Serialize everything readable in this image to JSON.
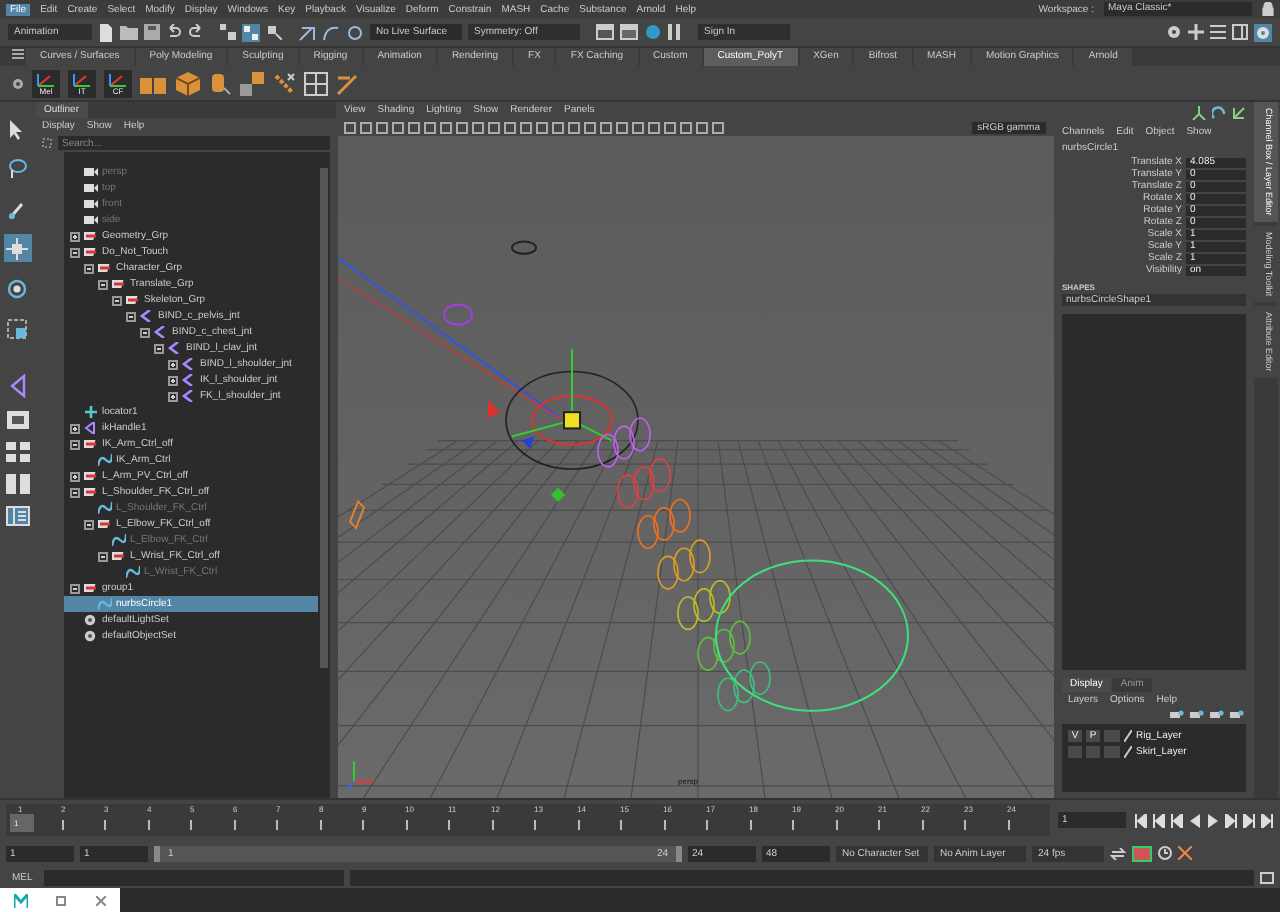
{
  "menu_bar": {
    "items": [
      {
        "label": "File",
        "selected": true
      },
      {
        "label": "Edit",
        "selected": false
      },
      {
        "label": "Create",
        "selected": false
      },
      {
        "label": "Select",
        "selected": false
      },
      {
        "label": "Modify",
        "selected": false
      },
      {
        "label": "Display",
        "selected": false
      },
      {
        "label": "Windows",
        "selected": false
      },
      {
        "label": "Key",
        "selected": false
      },
      {
        "label": "Playback",
        "selected": false
      },
      {
        "label": "Visualize",
        "selected": false
      },
      {
        "label": "Deform",
        "selected": false
      },
      {
        "label": "Constrain",
        "selected": false
      },
      {
        "label": "MASH",
        "selected": false
      },
      {
        "label": "Cache",
        "selected": false
      },
      {
        "label": "Substance",
        "selected": false
      },
      {
        "label": "Arnold",
        "selected": false
      },
      {
        "label": "Help",
        "selected": false
      }
    ],
    "workspace_label": "Workspace :",
    "workspace": "Maya Classic*"
  },
  "status_line": {
    "menu_set": "Animation",
    "live_surface": "No Live Surface",
    "symmetry": "Symmetry: Off",
    "sign_in": "Sign In"
  },
  "shelf": {
    "tabs": [
      {
        "label": "Curves / Surfaces",
        "selected": false
      },
      {
        "label": "Poly Modeling",
        "selected": false
      },
      {
        "label": "Sculpting",
        "selected": false
      },
      {
        "label": "Rigging",
        "selected": false
      },
      {
        "label": "Animation",
        "selected": false
      },
      {
        "label": "Rendering",
        "selected": false
      },
      {
        "label": "FX",
        "selected": false
      },
      {
        "label": "FX Caching",
        "selected": false
      },
      {
        "label": "Custom",
        "selected": false
      },
      {
        "label": "Custom_PolyT",
        "selected": true
      },
      {
        "label": "XGen",
        "selected": false
      },
      {
        "label": "Bifrost",
        "selected": false
      },
      {
        "label": "MASH",
        "selected": false
      },
      {
        "label": "Motion Graphics",
        "selected": false
      },
      {
        "label": "Arnold",
        "selected": false
      }
    ],
    "tools": [
      {
        "label": "Mel"
      },
      {
        "label": "IT"
      },
      {
        "label": "CF"
      }
    ]
  },
  "toolbox": {
    "tools": [
      {
        "kind": "select",
        "selected": false
      },
      {
        "kind": "lasso",
        "selected": false
      },
      {
        "kind": "paint",
        "selected": false
      },
      {
        "kind": "move",
        "selected": true
      },
      {
        "kind": "rotate",
        "selected": false
      },
      {
        "kind": "scale",
        "selected": false
      }
    ]
  },
  "outliner": {
    "title": "Outliner",
    "menu": [
      "Display",
      "Show",
      "Help"
    ],
    "search": {
      "placeholder": "Search..."
    },
    "items": [
      {
        "name": "persp",
        "kind": "camera",
        "dimmed": true,
        "selected": false
      },
      {
        "name": "top",
        "kind": "camera",
        "dimmed": true,
        "selected": false
      },
      {
        "name": "front",
        "kind": "camera",
        "dimmed": true,
        "selected": false
      },
      {
        "name": "side",
        "kind": "camera",
        "dimmed": true,
        "selected": false
      },
      {
        "name": "Geometry_Grp",
        "kind": "transform",
        "dimmed": false,
        "selected": false,
        "expanded": false
      },
      {
        "name": "Do_Not_Touch",
        "kind": "transform",
        "dimmed": false,
        "selected": false,
        "expanded": true,
        "children": [
          {
            "name": "Character_Grp",
            "kind": "transform",
            "dimmed": false,
            "selected": false,
            "expanded": true,
            "children": [
              {
                "name": "Translate_Grp",
                "kind": "transform",
                "dimmed": false,
                "selected": false,
                "expanded": true,
                "children": [
                  {
                    "name": "Skeleton_Grp",
                    "kind": "transform",
                    "dimmed": false,
                    "selected": false,
                    "expanded": true,
                    "children": [
                      {
                        "name": "BIND_c_pelvis_jnt",
                        "kind": "joint",
                        "dimmed": false,
                        "selected": false,
                        "expanded": true,
                        "children": [
                          {
                            "name": "BIND_c_chest_jnt",
                            "kind": "joint",
                            "dimmed": false,
                            "selected": false,
                            "expanded": true,
                            "children": [
                              {
                                "name": "BIND_l_clav_jnt",
                                "kind": "joint",
                                "dimmed": false,
                                "selected": false,
                                "expanded": true,
                                "children": [
                                  {
                                    "name": "BIND_l_shoulder_jnt",
                                    "kind": "joint",
                                    "dimmed": false,
                                    "selected": false,
                                    "expanded": false
                                  },
                                  {
                                    "name": "IK_l_shoulder_jnt",
                                    "kind": "joint",
                                    "dimmed": false,
                                    "selected": false,
                                    "expanded": false
                                  },
                                  {
                                    "name": "FK_l_shoulder_jnt",
                                    "kind": "joint",
                                    "dimmed": false,
                                    "selected": false,
                                    "expanded": false
                                  }
                                ]
                              }
                            ]
                          }
                        ]
                      }
                    ]
                  }
                ]
              }
            ]
          }
        ]
      },
      {
        "name": "locator1",
        "kind": "locator",
        "dimmed": false,
        "selected": false
      },
      {
        "name": "ikHandle1",
        "kind": "ik_handle",
        "dimmed": false,
        "selected": false,
        "expanded": false
      },
      {
        "name": "IK_Arm_Ctrl_off",
        "kind": "transform",
        "dimmed": false,
        "selected": false,
        "expanded": true,
        "children": [
          {
            "name": "IK_Arm_Ctrl",
            "kind": "curve",
            "dimmed": false,
            "selected": false
          }
        ]
      },
      {
        "name": "L_Arm_PV_Ctrl_off",
        "kind": "transform",
        "dimmed": false,
        "selected": false,
        "expanded": false
      },
      {
        "name": "L_Shoulder_FK_Ctrl_off",
        "kind": "transform",
        "dimmed": false,
        "selected": false,
        "expanded": true,
        "children": [
          {
            "name": "L_Shoulder_FK_Ctrl",
            "kind": "curve",
            "dimmed": true,
            "selected": false
          },
          {
            "name": "L_Elbow_FK_Ctrl_off",
            "kind": "transform",
            "dimmed": false,
            "selected": false,
            "expanded": true,
            "children": [
              {
                "name": "L_Elbow_FK_Ctrl",
                "kind": "curve",
                "dimmed": true,
                "selected": false
              },
              {
                "name": "L_Wrist_FK_Ctrl_off",
                "kind": "transform",
                "dimmed": false,
                "selected": false,
                "expanded": true,
                "children": [
                  {
                    "name": "L_Wrist_FK_Ctrl",
                    "kind": "curve",
                    "dimmed": true,
                    "selected": false
                  }
                ]
              }
            ]
          }
        ]
      },
      {
        "name": "group1",
        "kind": "transform",
        "dimmed": false,
        "selected": false,
        "expanded": true,
        "children": [
          {
            "name": "nurbsCircle1",
            "kind": "curve",
            "dimmed": false,
            "selected": true
          }
        ]
      },
      {
        "name": "defaultLightSet",
        "kind": "set",
        "dimmed": false,
        "selected": false
      },
      {
        "name": "defaultObjectSet",
        "kind": "set",
        "dimmed": false,
        "selected": false
      }
    ]
  },
  "viewport": {
    "menu": [
      "View",
      "Shading",
      "Lighting",
      "Show",
      "Renderer",
      "Panels"
    ],
    "color_space": "sRGB gamma",
    "camera": "persp"
  },
  "channel_box": {
    "menu": [
      "Channels",
      "Edit",
      "Object",
      "Show"
    ],
    "object": "nurbsCircle1",
    "channels": [
      {
        "name": "Translate X",
        "value": "4.085"
      },
      {
        "name": "Translate Y",
        "value": "0"
      },
      {
        "name": "Translate Z",
        "value": "0"
      },
      {
        "name": "Rotate X",
        "value": "0"
      },
      {
        "name": "Rotate Y",
        "value": "0"
      },
      {
        "name": "Rotate Z",
        "value": "0"
      },
      {
        "name": "Scale X",
        "value": "1"
      },
      {
        "name": "Scale Y",
        "value": "1"
      },
      {
        "name": "Scale Z",
        "value": "1"
      },
      {
        "name": "Visibility",
        "value": "on"
      }
    ],
    "shapes_label": "SHAPES",
    "shape": "nurbsCircleShape1"
  },
  "layer_editor": {
    "tabs": [
      {
        "label": "Display",
        "selected": true
      },
      {
        "label": "Anim",
        "selected": false
      }
    ],
    "menu": [
      "Layers",
      "Options",
      "Help"
    ],
    "layers": [
      {
        "name": "Rig_Layer",
        "visibility": "V",
        "playback": "P"
      },
      {
        "name": "Skirt_Layer"
      }
    ]
  },
  "side_tabs": [
    {
      "label": "Channel Box / Layer Editor",
      "selected": true
    },
    {
      "label": "Modeling Toolkit",
      "selected": false
    },
    {
      "label": "Attribute Editor",
      "selected": false
    }
  ],
  "time_slider": {
    "ticks": [
      "1",
      "2",
      "3",
      "4",
      "5",
      "6",
      "7",
      "8",
      "9",
      "10",
      "11",
      "12",
      "13",
      "14",
      "15",
      "16",
      "17",
      "18",
      "19",
      "20",
      "21",
      "22",
      "23",
      "24"
    ],
    "playhead_frame": "1",
    "current_frame": "1"
  },
  "range_slider": {
    "start": "1",
    "range_start": "1",
    "range_min": "1",
    "range_max": "24",
    "level": 1,
    "range_end": "24",
    "end": "48",
    "character_set": "No Character Set",
    "anim_layer": "No Anim Layer",
    "fps": "24 fps"
  },
  "command_line": {
    "language": "MEL"
  }
}
